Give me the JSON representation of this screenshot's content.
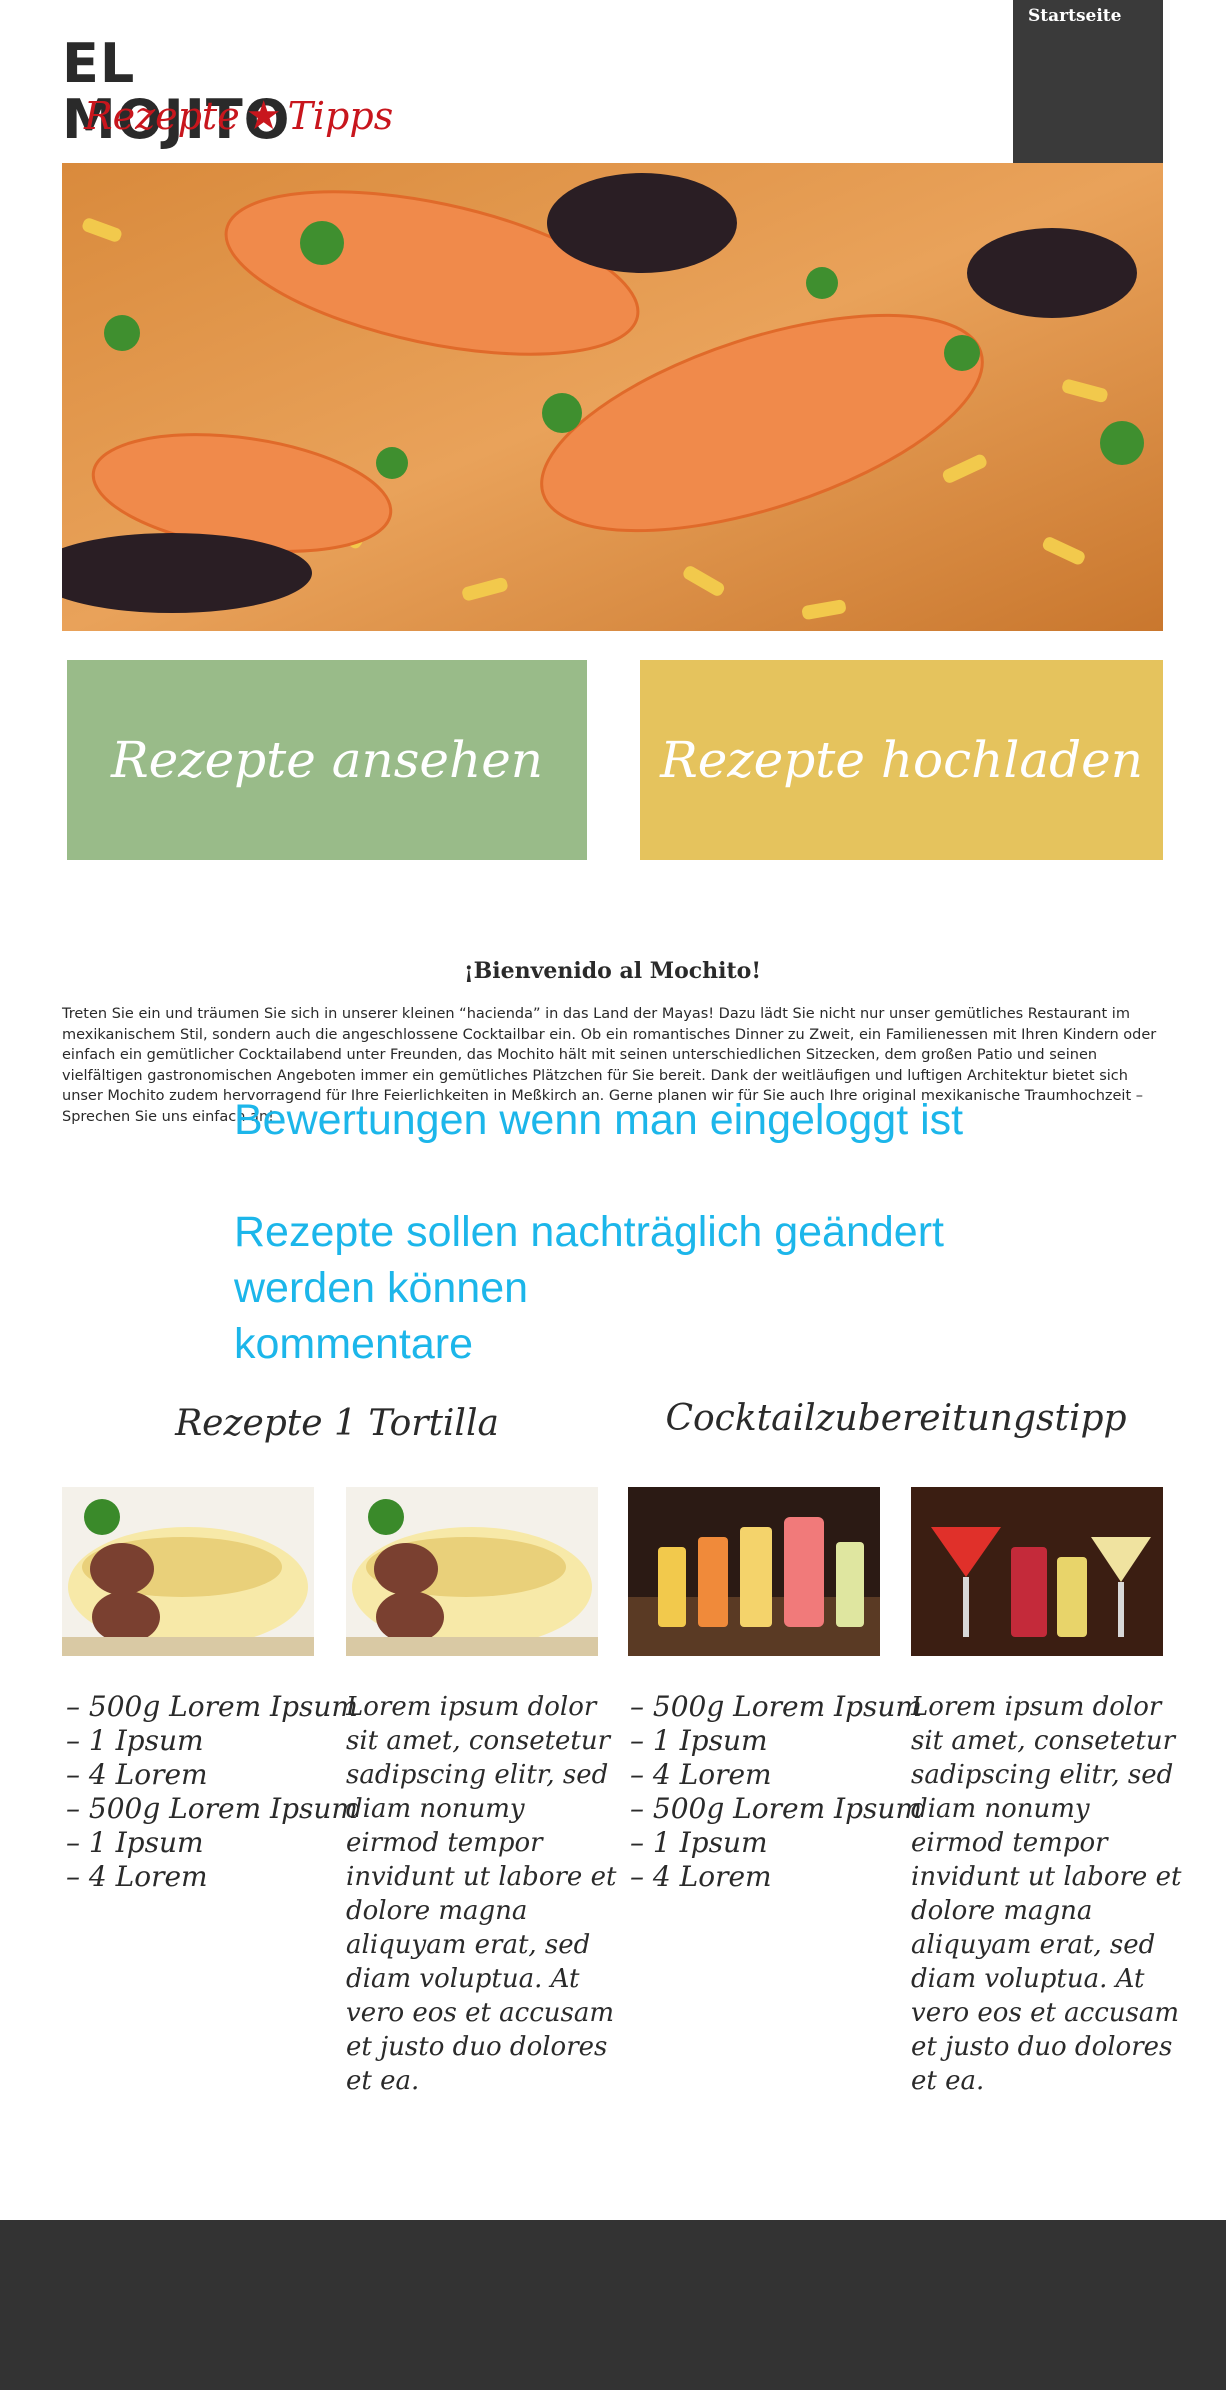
{
  "logo": {
    "title": "EL MOJITO",
    "sub_left": "Rezepte",
    "star": "★",
    "sub_right": "Tipps"
  },
  "nav": {
    "items": [
      {
        "label": "Startseite"
      }
    ]
  },
  "tiles": {
    "view_label": "Rezepte ansehen",
    "upload_label": "Rezepte hochladen"
  },
  "welcome": {
    "title": "¡Bienvenido al Mochito!",
    "text": "Treten Sie ein und träumen Sie sich in unserer kleinen “hacienda” in das Land der Mayas! Dazu lädt Sie nicht nur unser gemütliches Restaurant im mexikanischem Stil, sondern auch die angeschlossene Cocktailbar ein. Ob ein romantisches Dinner zu Zweit, ein Familienessen mit Ihren Kindern oder einfach ein gemütlicher Cocktailabend unter Freunden, das Mochito hält mit seinen unterschiedlichen Sitzecken, dem großen Patio und seinen vielfältigen gastronomischen Angeboten immer ein gemütliches Plätzchen für Sie bereit. Dank der weitläufigen und luftigen Architektur bietet sich unser Mochito zudem hervorragend für Ihre Feierlichkeiten in Meßkirch an. Gerne planen wir für Sie auch Ihre original mexikanische Traumhochzeit – Sprechen Sie uns einfach an!"
  },
  "notes": [
    "Bewertungen wenn man eingeloggt ist",
    "Rezepte sollen nachträglich geändert",
    "werden können",
    "kommentare"
  ],
  "sections": {
    "recipe_heading": "Rezepte 1 Tortilla",
    "cocktail_heading": "Cocktailzubereitungstipp"
  },
  "ingredients": [
    "– 500g Lorem Ipsum",
    "– 1 Ipsum",
    "– 4 Lorem",
    "– 500g Lorem Ipsum",
    "– 1 Ipsum",
    "– 4 Lorem"
  ],
  "lorem": "Lorem ipsum dolor sit amet, consetetur sadipscing elitr, sed diam nonumy eirmod tempor invidunt ut labore et dolore magna aliquyam erat, sed diam voluptua. At vero eos et accusam et justo duo dolores et ea.",
  "colors": {
    "accent_red": "#c8161d",
    "tile_green": "#99bb89",
    "tile_yellow": "#e5c35d",
    "note_blue": "#1cb6ea",
    "footer": "#333333"
  },
  "icons": {
    "logo_star": "star-icon"
  }
}
